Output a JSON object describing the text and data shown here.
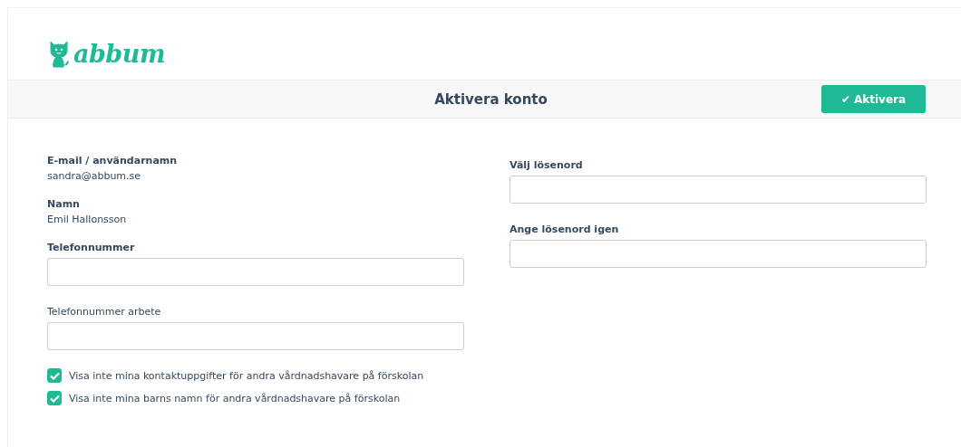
{
  "logo": {
    "text": "abbum"
  },
  "header": {
    "title": "Aktivera konto",
    "button": {
      "icon": "✔",
      "label": "Aktivera"
    }
  },
  "left": [
    {
      "kind": "info",
      "label": "E-mail / användarnamn",
      "value": "sandra@abbum.se"
    },
    {
      "kind": "info",
      "label": "Namn",
      "value": "Emil Hallonsson"
    },
    {
      "kind": "field",
      "label": "Telefonnummer",
      "bold": true
    },
    {
      "kind": "field",
      "label": "Telefonnummer arbete",
      "bold": false
    }
  ],
  "checkboxes": [
    {
      "label": "Visa inte mina kontaktuppgifter för andra vårdnadshavare på förskolan",
      "checked": true
    },
    {
      "label": "Visa inte mina barns namn för andra vårdnadshavare på förskolan",
      "checked": true
    }
  ],
  "right": [
    {
      "kind": "field",
      "label": "Välj lösenord",
      "bold": true
    },
    {
      "kind": "field",
      "label": "Ange lösenord igen",
      "bold": true
    }
  ]
}
